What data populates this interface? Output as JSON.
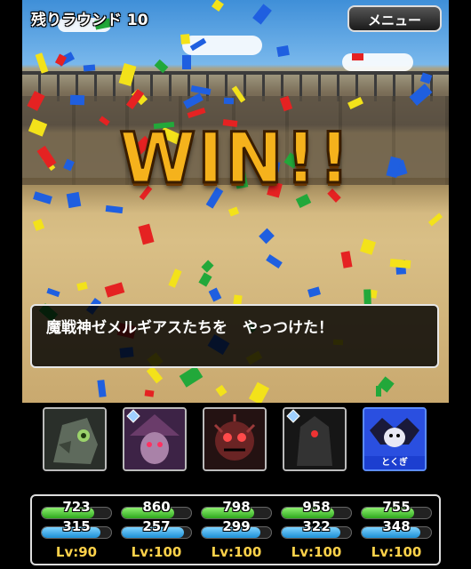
{
  "header": {
    "round_label": "残りラウンド 10",
    "menu_label": "メニュー"
  },
  "banner": {
    "text": "WIN!!"
  },
  "message": {
    "text": "魔戦神ゼメルギアスたちを　やっつけた！"
  },
  "party": [
    {
      "name": "party-slot-1",
      "color": "#3a4a3a",
      "has_rank_icon": false,
      "tag": ""
    },
    {
      "name": "party-slot-2",
      "color": "#4b2b55",
      "has_rank_icon": true,
      "tag": ""
    },
    {
      "name": "party-slot-3",
      "color": "#3a1414",
      "has_rank_icon": false,
      "tag": ""
    },
    {
      "name": "party-slot-4",
      "color": "#1f1f1f",
      "has_rank_icon": true,
      "tag": ""
    },
    {
      "name": "party-slot-5",
      "color": "#2448d6",
      "has_rank_icon": false,
      "tag": "とくぎ"
    }
  ],
  "stats": [
    {
      "hp": "723",
      "mp": "315",
      "lv": "Lv:90",
      "hp_fill": 0.75,
      "mp_fill": 0.85
    },
    {
      "hp": "860",
      "mp": "257",
      "lv": "Lv:100",
      "hp_fill": 0.75,
      "mp_fill": 0.9
    },
    {
      "hp": "798",
      "mp": "299",
      "lv": "Lv:100",
      "hp_fill": 0.75,
      "mp_fill": 0.85
    },
    {
      "hp": "958",
      "mp": "322",
      "lv": "Lv:100",
      "hp_fill": 0.75,
      "mp_fill": 0.85
    },
    {
      "hp": "755",
      "mp": "348",
      "lv": "Lv:100",
      "hp_fill": 0.75,
      "mp_fill": 0.85
    }
  ],
  "colors": {
    "confetti": [
      "#e52222",
      "#1f5fe0",
      "#f3e21a",
      "#22a83a"
    ]
  }
}
